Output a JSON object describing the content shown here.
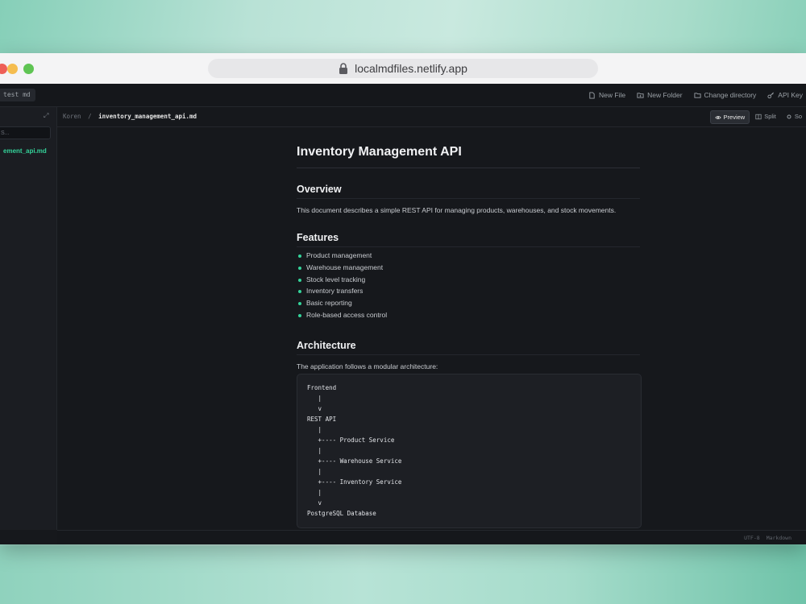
{
  "browser": {
    "url": "localmdfiles.netlify.app"
  },
  "topbar": {
    "open_tab": "test md",
    "actions": [
      {
        "label": "New File",
        "icon": "file-icon"
      },
      {
        "label": "New Folder",
        "icon": "folder-plus-icon"
      },
      {
        "label": "Change directory",
        "icon": "folder-icon"
      },
      {
        "label": "API Key",
        "icon": "key-icon"
      }
    ]
  },
  "sidebar": {
    "search_placeholder": "S...",
    "active_file": "ement_api.md"
  },
  "breadcrumb": {
    "root": "Koren",
    "separator": "/",
    "current": "inventory_management_api.md"
  },
  "view_tabs": {
    "preview": "Preview",
    "split": "Split",
    "source": "So"
  },
  "document": {
    "title": "Inventory Management API",
    "overview_heading": "Overview",
    "overview_text": "This document describes a simple REST API for managing products, warehouses, and stock movements.",
    "features_heading": "Features",
    "features": [
      "Product management",
      "Warehouse management",
      "Stock level tracking",
      "Inventory transfers",
      "Basic reporting",
      "Role-based access control"
    ],
    "architecture_heading": "Architecture",
    "architecture_text": "The application follows a modular architecture:",
    "code_lines": [
      "Frontend",
      "   |",
      "   v",
      "REST API",
      "   |",
      "   +---- Product Service",
      "   |",
      "   +---- Warehouse Service",
      "   |",
      "   +---- Inventory Service",
      "   |",
      "   v",
      "PostgreSQL Database"
    ]
  },
  "statusbar": {
    "encoding": "UTF-8",
    "mode": "Markdown"
  },
  "colors": {
    "accent": "#34d39a",
    "app_bg": "#16181c"
  }
}
